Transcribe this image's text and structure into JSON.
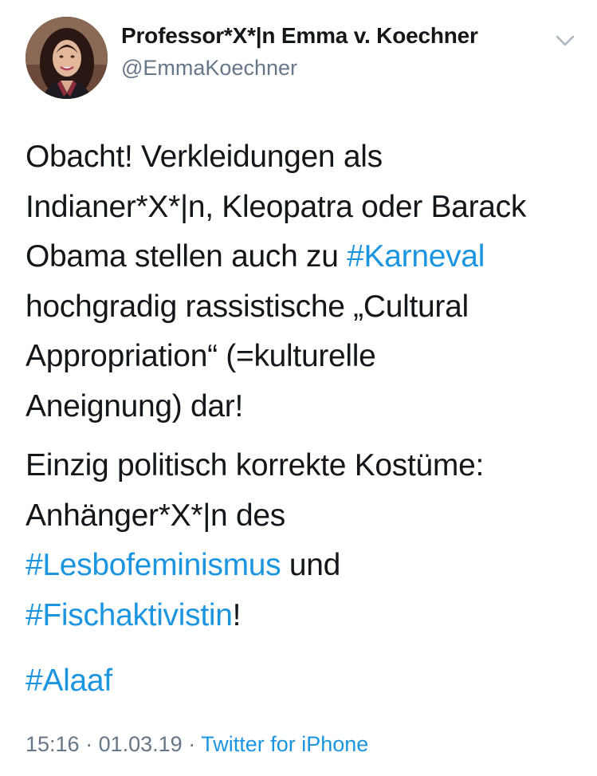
{
  "author": {
    "display_name": "Professor*X*|n Emma v. Koechner",
    "handle": "@EmmaKoechner",
    "avatar_icon": "profile-photo"
  },
  "menu": {
    "icon": "chevron-down-icon"
  },
  "tweet": {
    "para1": {
      "line1": "Obacht! Verkleidungen als",
      "line2": "Indianer*X*|n, Kleopatra oder Barack",
      "line3_pre": "Obama stellen auch zu ",
      "hashtag_karneval": "#Karneval",
      "line4": "hochgradig rassistische „Cultural",
      "line5": "Appropriation“ (=kulturelle",
      "line6": "Aneignung) dar!"
    },
    "para2": {
      "line1": "Einzig politisch korrekte Kostüme:",
      "line2": "Anhänger*X*|n des",
      "hashtag_lesbo": "#Lesbofeminismus",
      "line3_post": " und",
      "hashtag_fisch": "#Fischaktivistin",
      "line4_post": "!"
    },
    "para3": {
      "hashtag_alaaf": "#Alaaf"
    }
  },
  "meta": {
    "time": "15:16",
    "separator": " · ",
    "date": "01.03.19",
    "source": "Twitter for iPhone"
  },
  "colors": {
    "text": "#14171a",
    "secondary": "#657786",
    "link": "#1b95e0"
  }
}
